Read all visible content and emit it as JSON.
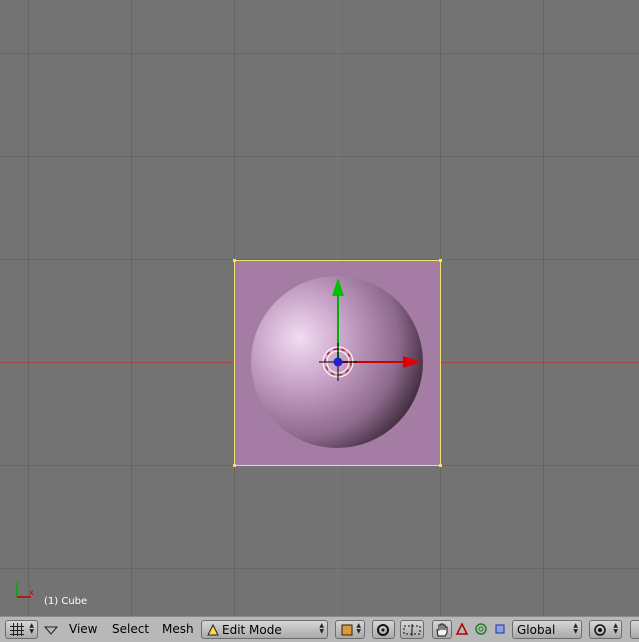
{
  "viewport": {
    "object_label": "(1) Cube",
    "colors": {
      "background": "#737373",
      "grid": "#666666",
      "x_axis": "#a04848",
      "y_axis": "#4a9a4a",
      "face": "#a47ca4",
      "selected_edge": "#f0e070",
      "sphere_highlight": "#f2dcf2",
      "sphere_shadow": "#3a2838"
    }
  },
  "header": {
    "menus": {
      "view": "View",
      "select": "Select",
      "mesh": "Mesh"
    },
    "mode": {
      "label": "Edit Mode"
    },
    "orientation": {
      "label": "Global"
    },
    "icons": [
      "grid-editor-type-icon",
      "menu-collapse-icon",
      "pivot-point-icon",
      "proportional-edit-icon",
      "snap-icon",
      "hand-manipulator-icon",
      "translate-icon",
      "rotate-icon",
      "scale-icon",
      "layer-icon"
    ]
  }
}
